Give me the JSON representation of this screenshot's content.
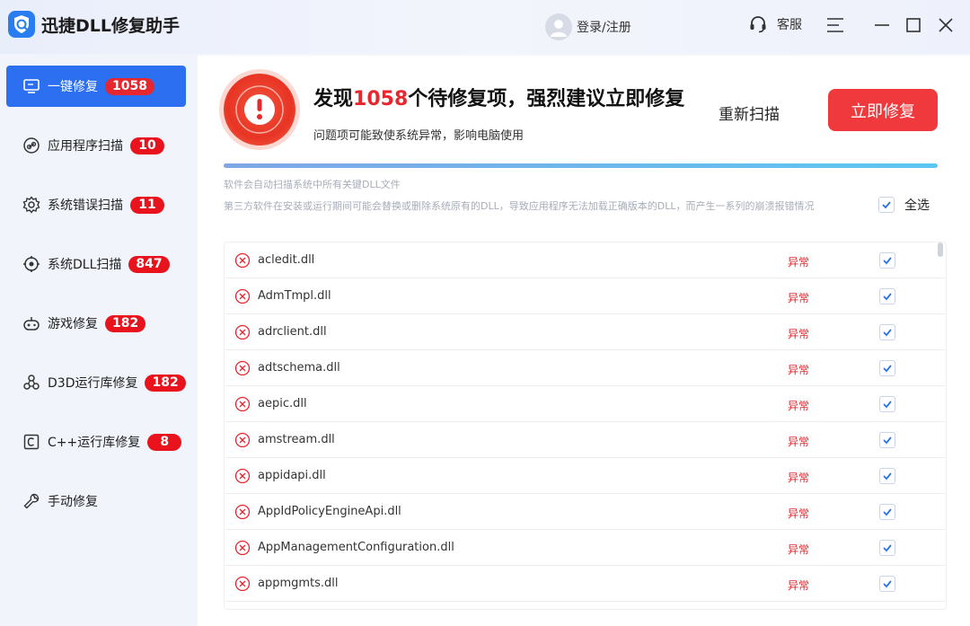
{
  "app": {
    "title": "迅捷DLL修复助手",
    "login_label": "登录/注册",
    "service_label": "客服"
  },
  "sidebar": {
    "items": [
      {
        "label": "一键修复",
        "badge": "1058",
        "icon": "monitor-icon",
        "active": true
      },
      {
        "label": "应用程序扫描",
        "badge": "10",
        "icon": "link-icon",
        "active": false
      },
      {
        "label": "系统错误扫描",
        "badge": "11",
        "icon": "gear-icon",
        "active": false
      },
      {
        "label": "系统DLL扫描",
        "badge": "847",
        "icon": "target-icon",
        "active": false
      },
      {
        "label": "游戏修复",
        "badge": "182",
        "icon": "gamepad-icon",
        "active": false
      },
      {
        "label": "D3D运行库修复",
        "badge": "182",
        "icon": "molecule-icon",
        "active": false
      },
      {
        "label": "C++运行库修复",
        "badge": "8",
        "icon": "c-box-icon",
        "active": false
      },
      {
        "label": "手动修复",
        "badge": "",
        "icon": "wrench-icon",
        "active": false
      }
    ]
  },
  "summary": {
    "headline_prefix": "发现",
    "headline_count": "1058",
    "headline_suffix": "个待修复项，强烈建议立即修复",
    "subline": "问题项可能致使系统异常，影响电脑使用",
    "rescan_label": "重新扫描",
    "fix_label": "立即修复",
    "progress": 1.0,
    "info_line1": "软件会自动扫描系统中所有关键DLL文件",
    "info_line2": "第三方软件在安装或运行期间可能会替换或删除系统原有的DLL，导致应用程序无法加载正确版本的DLL，而产生一系列的崩溃报错情况",
    "select_all_label": "全选",
    "select_all_checked": true
  },
  "dll_list": [
    {
      "name": "acledit.dll",
      "status": "异常",
      "checked": true
    },
    {
      "name": "AdmTmpl.dll",
      "status": "异常",
      "checked": true
    },
    {
      "name": "adrclient.dll",
      "status": "异常",
      "checked": true
    },
    {
      "name": "adtschema.dll",
      "status": "异常",
      "checked": true
    },
    {
      "name": "aepic.dll",
      "status": "异常",
      "checked": true
    },
    {
      "name": "amstream.dll",
      "status": "异常",
      "checked": true
    },
    {
      "name": "appidapi.dll",
      "status": "异常",
      "checked": true
    },
    {
      "name": "AppIdPolicyEngineApi.dll",
      "status": "异常",
      "checked": true
    },
    {
      "name": "AppManagementConfiguration.dll",
      "status": "异常",
      "checked": true
    },
    {
      "name": "appmgmts.dll",
      "status": "异常",
      "checked": true
    }
  ],
  "colors": {
    "accent": "#2c6ff0",
    "danger": "#e8262e",
    "fix_button": "#f0393d"
  }
}
